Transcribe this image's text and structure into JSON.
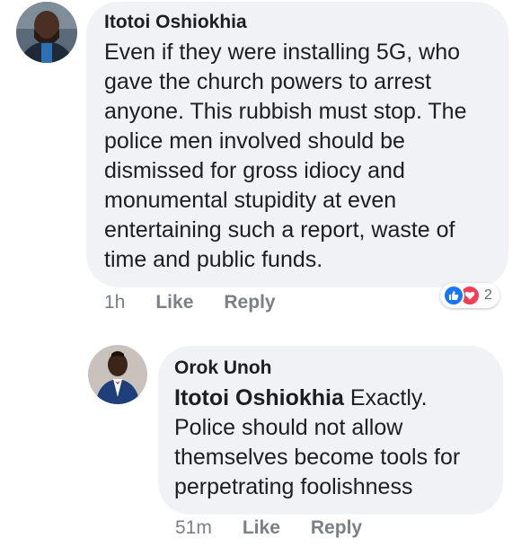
{
  "comment": {
    "author": "Itotoi Oshiokhia",
    "text": "Even if they were installing 5G, who gave the church powers to arrest anyone. This rubbish must stop. The police men involved should be dismissed for gross idiocy and monumental stupidity at even entertaining such a report, waste of time and public funds.",
    "time": "1h",
    "like_label": "Like",
    "reply_label": "Reply",
    "reaction_count": "2",
    "reactions": [
      "like-icon",
      "love-icon"
    ]
  },
  "reply": {
    "author": "Orok Unoh",
    "mention": "Itotoi Oshiokhia",
    "text": " Exactly. Police should not allow themselves become tools for perpetrating foolishness",
    "time": "51m",
    "like_label": "Like",
    "reply_label": "Reply"
  },
  "colors": {
    "bubble": "#f0f2f5",
    "meta": "#7b7f86",
    "like": "#1877f2",
    "love": "#f33e58"
  }
}
